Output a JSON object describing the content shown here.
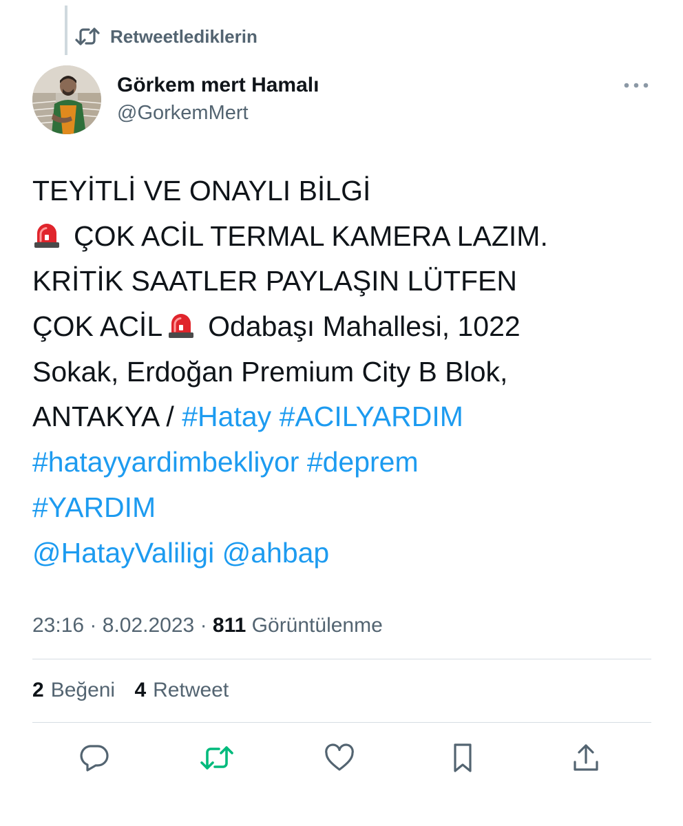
{
  "retweet_context": {
    "label": "Retweetlediklerin",
    "icon": "retweet-icon"
  },
  "author": {
    "display_name": "Görkem mert Hamalı",
    "handle": "@GorkemMert",
    "avatar": "profile-photo"
  },
  "tweet": {
    "lines": [
      {
        "text": "TEYİTLİ VE ONAYLI BİLGİ"
      },
      {
        "emoji": "siren",
        "text": "ÇOK ACİL TERMAL KAMERA LAZIM."
      },
      {
        "text": "KRİTİK SAATLER PAYLAŞIN LÜTFEN"
      },
      {
        "text_before": "ÇOK ACİL",
        "emoji": "siren",
        "text_after": "Odabaşı Mahallesi, 1022"
      },
      {
        "text": "Sokak, Erdoğan Premium City B Blok,"
      },
      {
        "text": "ANTAKYA /",
        "hashtags": [
          "#Hatay",
          "#ACILYARDIM"
        ]
      },
      {
        "hashtags": [
          "#hatayyardimbekliyor",
          "#deprem"
        ]
      },
      {
        "hashtags": [
          "#YARDIM"
        ]
      },
      {
        "mentions": [
          "@HatayValiligi",
          "@ahbap"
        ]
      }
    ]
  },
  "meta": {
    "time": "23:16",
    "date": "8.02.2023",
    "separator": "·",
    "views_count": "811",
    "views_label": "Görüntülenme"
  },
  "stats": {
    "likes_count": "2",
    "likes_label": "Beğeni",
    "retweets_count": "4",
    "retweets_label": "Retweet"
  },
  "actions": [
    "reply-icon",
    "retweet-icon",
    "like-icon",
    "bookmark-icon",
    "share-icon"
  ],
  "colors": {
    "text": "#0f1419",
    "secondary": "#536471",
    "link": "#1d9bf0",
    "retweet_active": "#00ba7c",
    "divider": "#d5dde2",
    "siren_red": "#e0252c"
  }
}
